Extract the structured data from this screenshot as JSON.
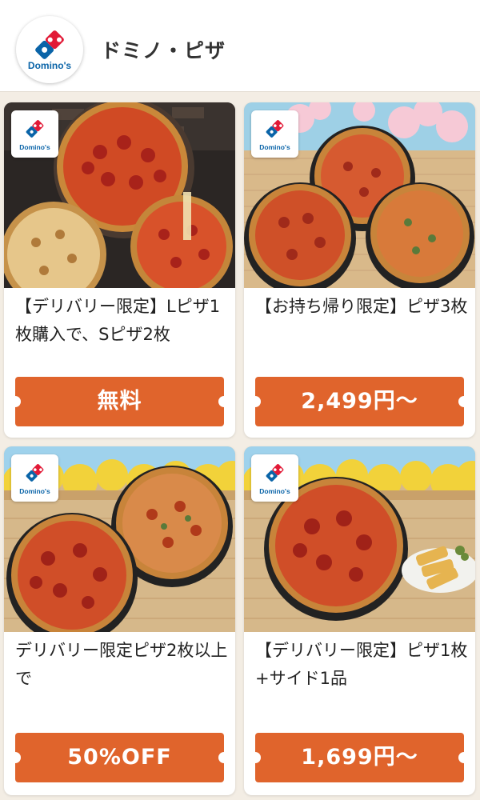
{
  "header": {
    "brand_name": "ドミノ・ピザ",
    "logo_text": "Domino's",
    "logo_icon": "dominos-logo-icon"
  },
  "colors": {
    "accent": "#e0642c",
    "logo_blue": "#0a64a8",
    "logo_red": "#e21a37"
  },
  "offers": [
    {
      "badge": "Domino's",
      "title": "【デリバリー限定】Lピザ1枚購入で、Sピザ2枚",
      "price": "無料",
      "theme": "dark-wood"
    },
    {
      "badge": "Domino's",
      "title": "【お持ち帰り限定】ピザ3枚",
      "price": "2,499円〜",
      "theme": "cherry-blossom"
    },
    {
      "badge": "Domino's",
      "title": "デリバリー限定ピザ2枚以上で",
      "price": "50%OFF",
      "theme": "rapeseed-flowers"
    },
    {
      "badge": "Domino's",
      "title": "【デリバリー限定】ピザ1枚+サイド1品",
      "price": "1,699円〜",
      "theme": "rapeseed-flowers"
    }
  ]
}
